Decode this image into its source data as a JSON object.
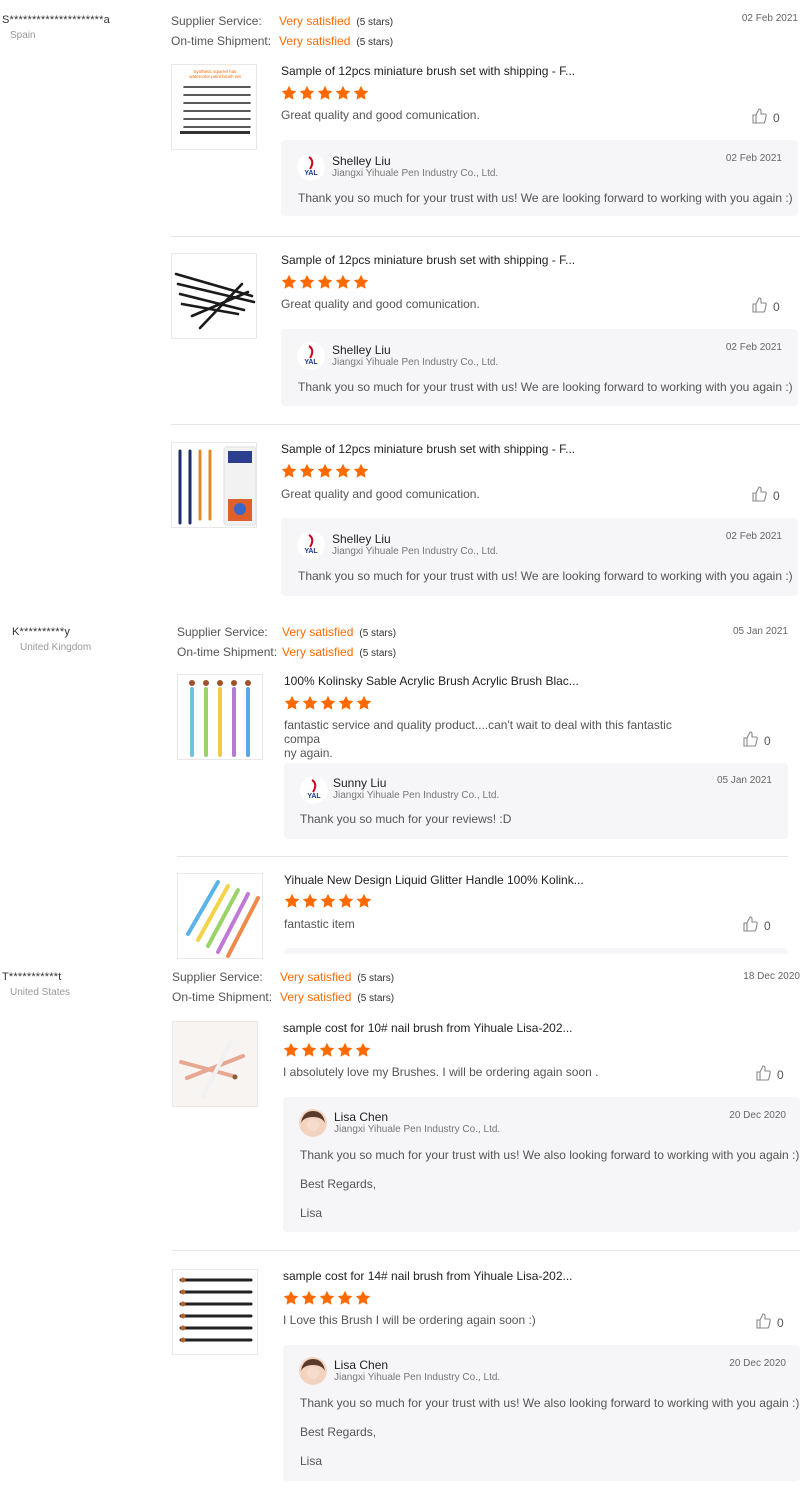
{
  "colors": {
    "accent": "#ff6a00",
    "reply_bg": "#f6f6f8"
  },
  "labels": {
    "supplier_service": "Supplier Service:",
    "on_time_shipment": "On-time Shipment:"
  },
  "reviews": [
    {
      "reviewer": "S*********************a",
      "country": "Spain",
      "supplier_service": "Very satisfied",
      "supplier_stars": "(5 stars)",
      "shipment": "Very satisfied",
      "shipment_stars": "(5 stars)",
      "date": "02 Feb 2021",
      "items": [
        {
          "thumb_icon": "brush-set-thumbnail",
          "thumb_caption": "Synthetic squirrel hair watercolor paint brush set",
          "title": "Sample of 12pcs miniature brush set with shipping - F...",
          "rating": 5,
          "comment": "Great quality and good comunication.",
          "likes": "0",
          "reply": {
            "name": "Shelley Liu",
            "company": "Jiangxi Yihuale Pen Industry Co., Ltd.",
            "date": "02 Feb 2021",
            "lines": [
              "Thank you so much for your trust with us! We are looking forward to working with you again :)"
            ]
          }
        },
        {
          "thumb_icon": "brush-fan-thumbnail",
          "title": "Sample of 12pcs miniature brush set with shipping - F...",
          "rating": 5,
          "comment": "Great quality and good comunication.",
          "likes": "0",
          "reply": {
            "name": "Shelley Liu",
            "company": "Jiangxi Yihuale Pen Industry Co., Ltd.",
            "date": "02 Feb 2021",
            "lines": [
              "Thank you so much for your trust with us! We are looking forward to working with you again :)"
            ]
          }
        },
        {
          "thumb_icon": "brush-box-thumbnail",
          "title": "Sample of 12pcs miniature brush set with shipping - F...",
          "rating": 5,
          "comment": "Great quality and good comunication.",
          "likes": "0",
          "reply": {
            "name": "Shelley Liu",
            "company": "Jiangxi Yihuale Pen Industry Co., Ltd.",
            "date": "02 Feb 2021",
            "lines": [
              "Thank you so much for your trust with us! We are looking forward to working with you again :)"
            ]
          }
        }
      ]
    },
    {
      "reviewer": "K**********y",
      "country": "United Kingdom",
      "supplier_service": "Very satisfied",
      "supplier_stars": "(5 stars)",
      "shipment": "Very satisfied",
      "shipment_stars": "(5 stars)",
      "date": "05 Jan 2021",
      "items": [
        {
          "thumb_icon": "acrylic-brush-thumbnail",
          "title": "100% Kolinsky Sable Acrylic Brush Acrylic Brush Blac...",
          "rating": 5,
          "comment_lines": [
            "fantastic service and quality product....can't wait to deal with this fantastic compa",
            "ny again."
          ],
          "likes": "0",
          "reply": {
            "name": "Sunny Liu",
            "company": "Jiangxi Yihuale Pen Industry Co., Ltd.",
            "date": "05 Jan 2021",
            "lines": [
              "Thank you so much for your reviews!  :D"
            ]
          }
        },
        {
          "thumb_icon": "glitter-brush-thumbnail",
          "title": "Yihuale New Design Liquid Glitter Handle 100% Kolink...",
          "rating": 5,
          "comment": "fantastic item",
          "likes": "0"
        }
      ]
    },
    {
      "reviewer": "T***********t",
      "country": "United States",
      "supplier_service": "Very satisfied",
      "supplier_stars": "(5 stars)",
      "shipment": "Very satisfied",
      "shipment_stars": "(5 stars)",
      "date": "18 Dec 2020",
      "items": [
        {
          "thumb_icon": "nail-brush-thumbnail",
          "title": "sample cost for 10# nail brush from Yihuale Lisa-202...",
          "rating": 5,
          "comment": "I absolutely love my Brushes. I will be ordering again soon .",
          "likes": "0",
          "reply": {
            "name": "Lisa Chen",
            "company": "Jiangxi Yihuale Pen Industry Co., Ltd.",
            "date": "20 Dec 2020",
            "lines": [
              "Thank you so much for your trust with us! We also looking forward to working with you again :)",
              "Best Regards,",
              "Lisa"
            ]
          }
        },
        {
          "thumb_icon": "nail-brush-set-thumbnail",
          "title": "sample cost for 14# nail brush from Yihuale Lisa-202...",
          "rating": 5,
          "comment": "I Love this Brush I will be ordering again soon :)",
          "likes": "0",
          "reply": {
            "name": "Lisa Chen",
            "company": "Jiangxi Yihuale Pen Industry Co., Ltd.",
            "date": "20 Dec 2020",
            "lines": [
              "Thank you so much for your trust with us! We also looking forward to working with you again :)",
              "Best Regards,",
              "Lisa"
            ]
          }
        }
      ]
    }
  ]
}
